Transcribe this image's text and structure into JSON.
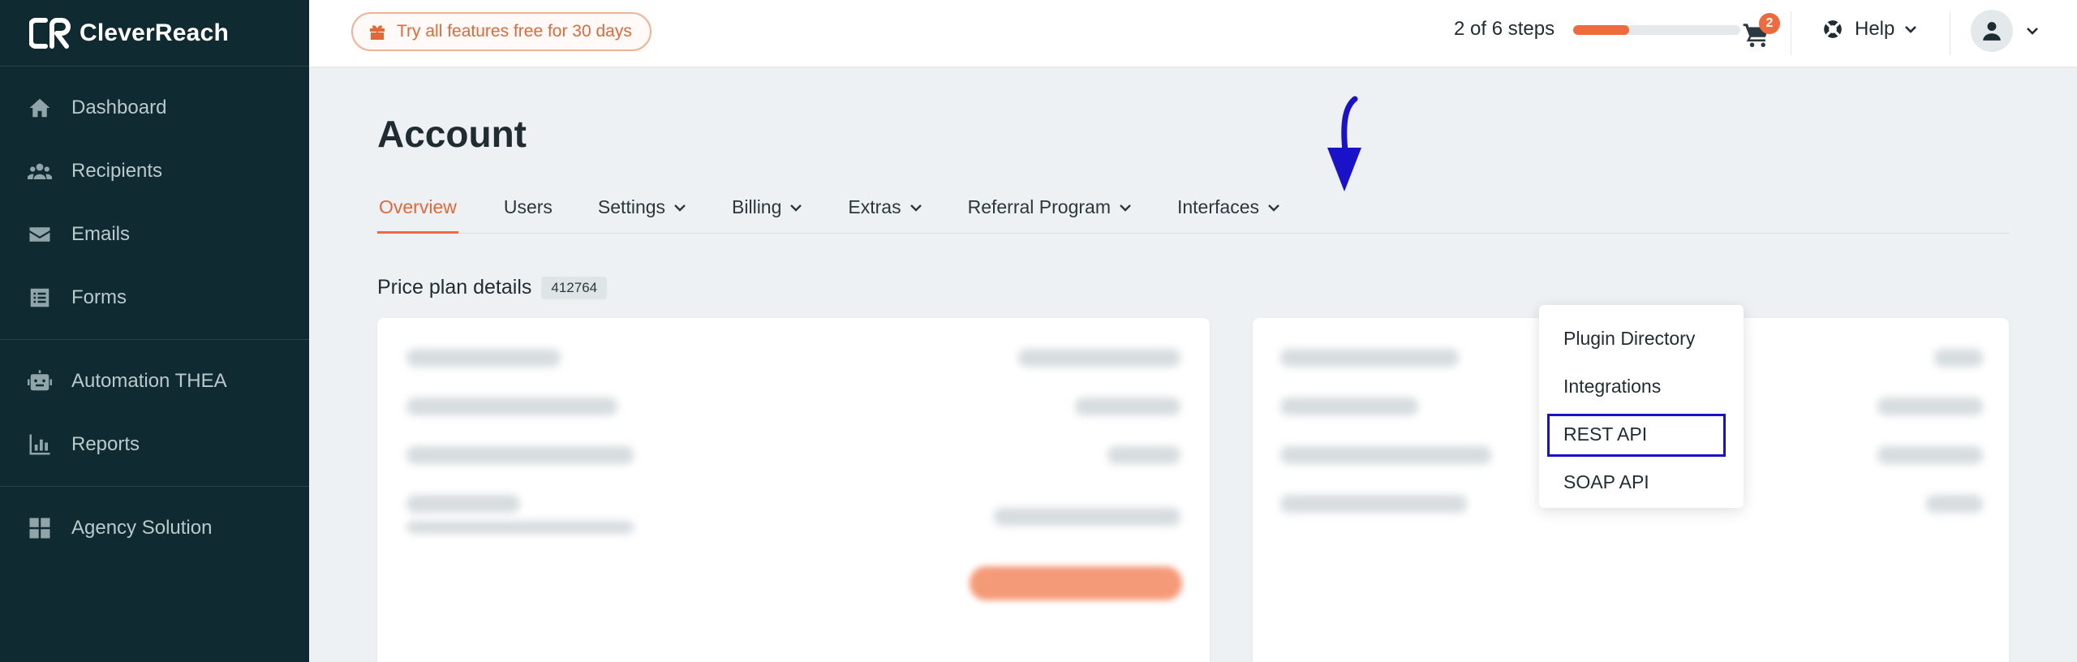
{
  "brand": {
    "name": "CleverReach"
  },
  "sidebar": {
    "groups": [
      [
        {
          "label": "Dashboard",
          "icon": "home-icon"
        },
        {
          "label": "Recipients",
          "icon": "users-icon"
        },
        {
          "label": "Emails",
          "icon": "envelope-icon"
        },
        {
          "label": "Forms",
          "icon": "form-icon"
        }
      ],
      [
        {
          "label": "Automation THEA",
          "icon": "robot-icon"
        },
        {
          "label": "Reports",
          "icon": "chart-icon"
        }
      ],
      [
        {
          "label": "Agency Solution",
          "icon": "grid-icon"
        }
      ]
    ]
  },
  "topbar": {
    "trial_label": "Try all features free for 30 days",
    "steps_label": "2 of 6 steps",
    "steps_done": 2,
    "steps_total": 6,
    "cart_count": "2",
    "help_label": "Help"
  },
  "page": {
    "title": "Account",
    "tabs": [
      {
        "label": "Overview",
        "active": true,
        "dropdown": false
      },
      {
        "label": "Users",
        "active": false,
        "dropdown": false
      },
      {
        "label": "Settings",
        "active": false,
        "dropdown": true
      },
      {
        "label": "Billing",
        "active": false,
        "dropdown": true
      },
      {
        "label": "Extras",
        "active": false,
        "dropdown": true
      },
      {
        "label": "Referral Program",
        "active": false,
        "dropdown": true
      },
      {
        "label": "Interfaces",
        "active": false,
        "dropdown": true
      }
    ],
    "price_plan_title": "Price plan details",
    "price_plan_id": "412764"
  },
  "interfaces_menu": {
    "items": [
      {
        "label": "Plugin Directory",
        "highlighted": false
      },
      {
        "label": "Integrations",
        "highlighted": false
      },
      {
        "label": "REST API",
        "highlighted": true
      },
      {
        "label": "SOAP API",
        "highlighted": false
      }
    ]
  },
  "colors": {
    "sidebar_bg": "#0f2a31",
    "accent": "#ef6b3d",
    "annotation": "#1a12c9"
  }
}
